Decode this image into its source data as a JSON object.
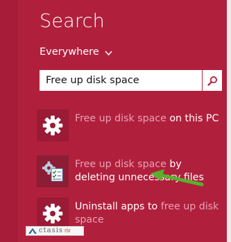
{
  "search": {
    "title": "Search",
    "scope": "Everywhere",
    "query": "Free up disk space"
  },
  "results": [
    {
      "highlight": "Free up disk space",
      "rest": " on this PC",
      "icon": "gear-icon"
    },
    {
      "highlight": "Free up disk space",
      "rest": " by deleting unnecessary files",
      "icon": "disk-cleanup-icon"
    },
    {
      "prefix": "Uninstall apps to ",
      "highlight": "free up disk space",
      "icon": "gear-icon"
    }
  ],
  "watermark": {
    "main": "ctasis",
    "sub": "ISI"
  },
  "colors": {
    "panel": "#b0203d",
    "highlight_text": "#e6a2b3",
    "arrow": "#58b12b"
  }
}
